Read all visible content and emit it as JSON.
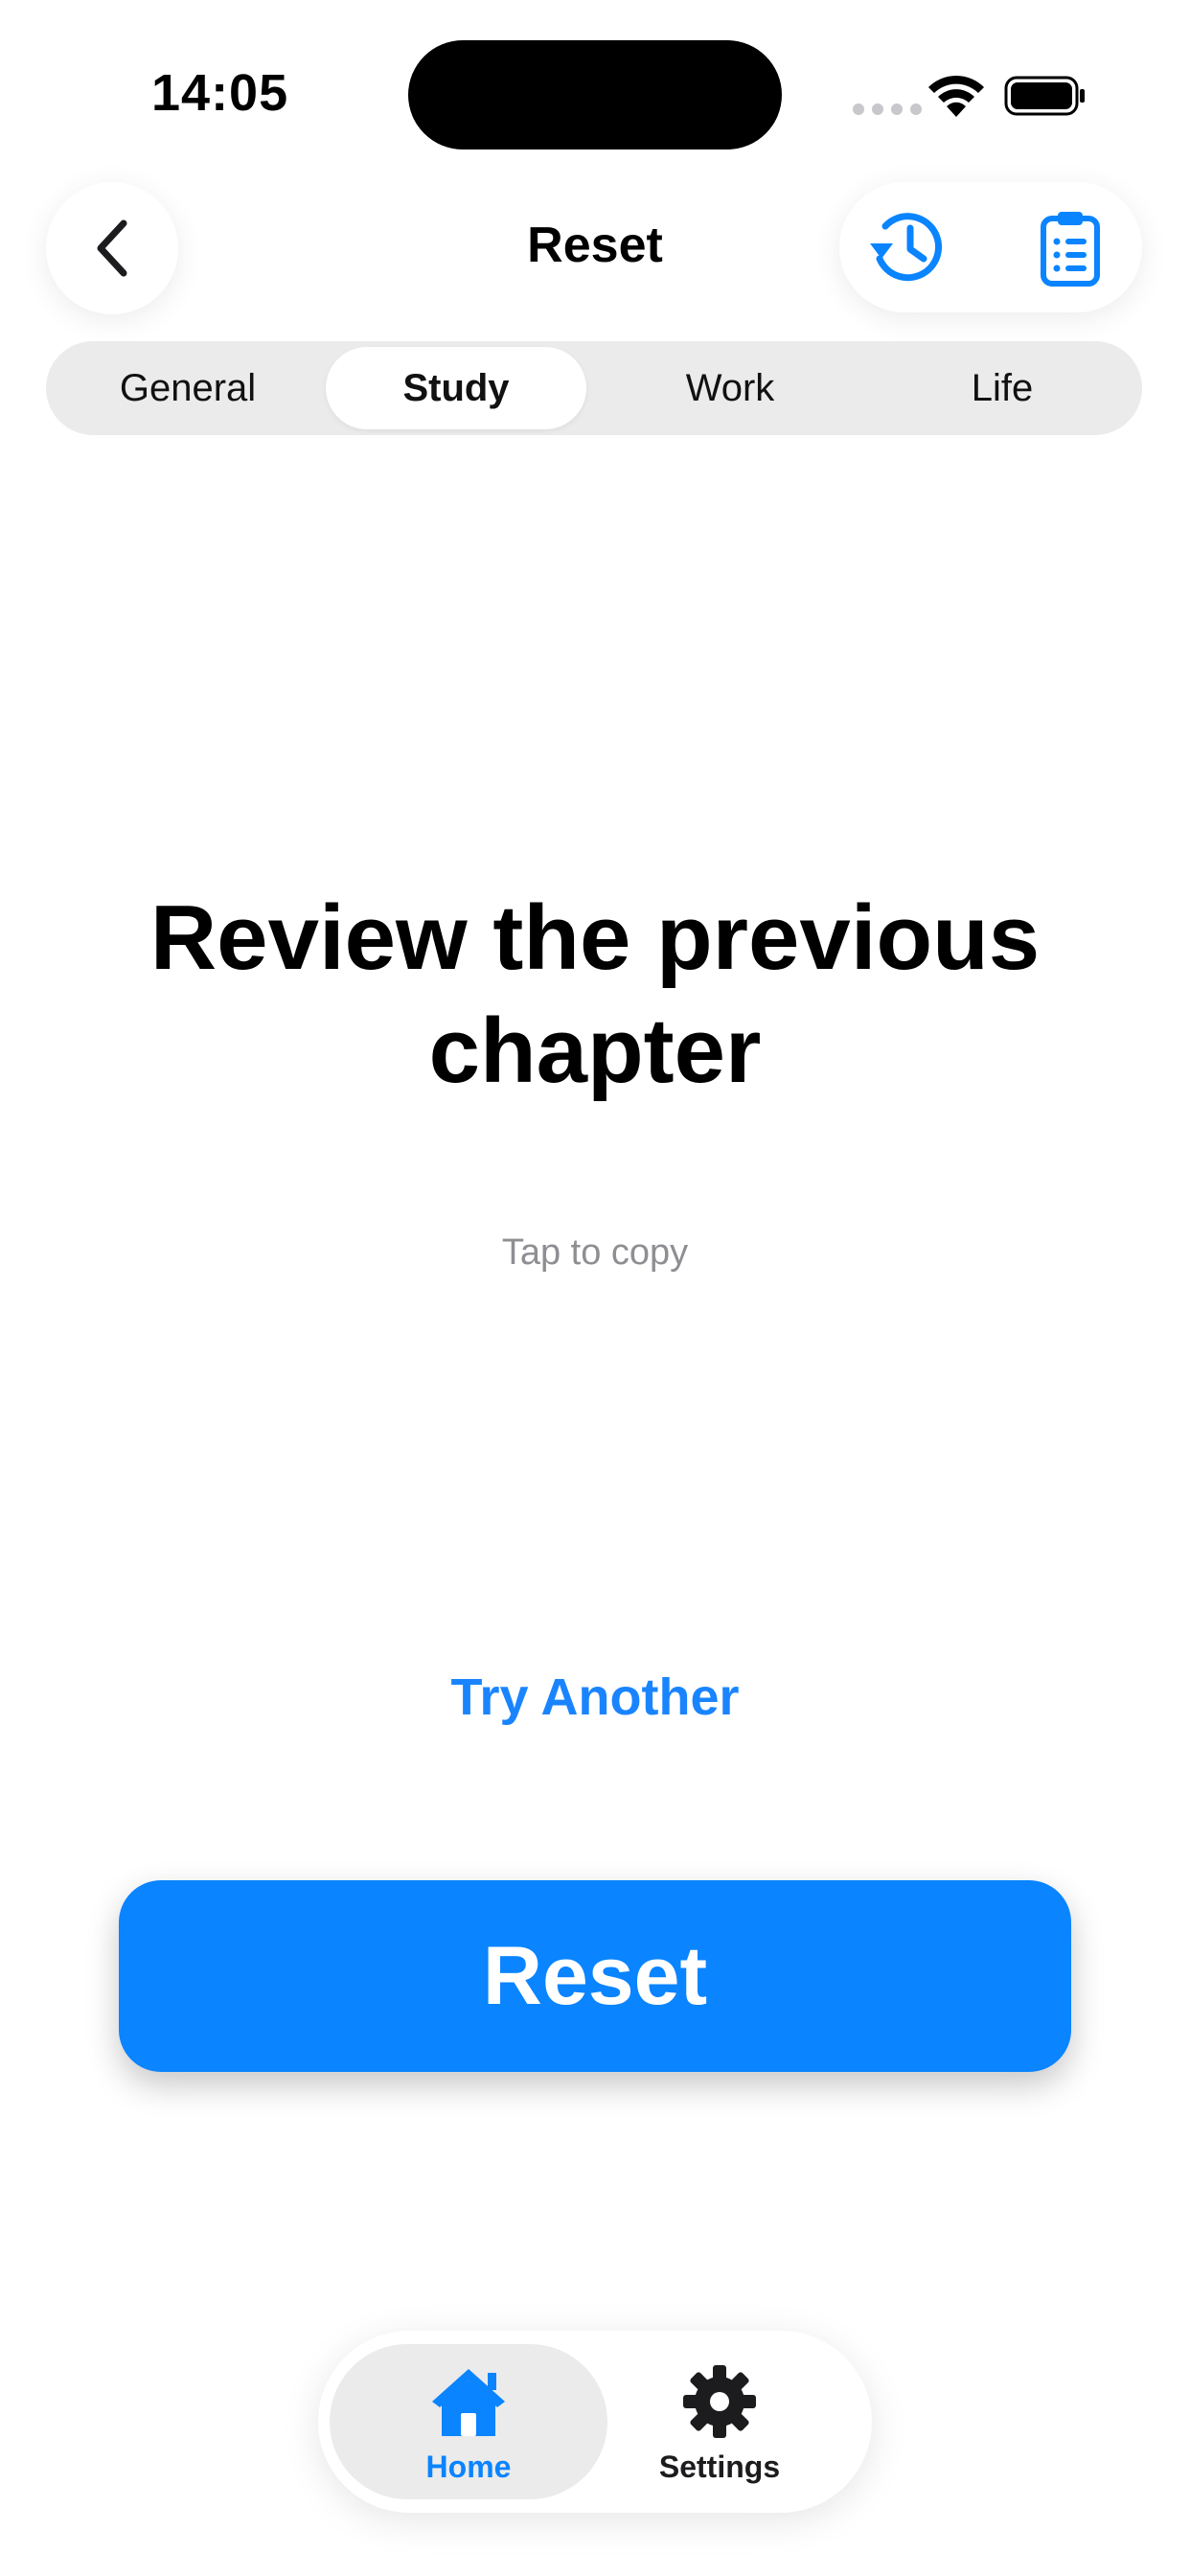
{
  "status_bar": {
    "time": "14:05"
  },
  "nav": {
    "title": "Reset",
    "back_icon": "chevron-left-icon",
    "history_icon": "clock-history-icon",
    "clipboard_icon": "clipboard-list-icon"
  },
  "segments": [
    {
      "label": "General",
      "selected": false
    },
    {
      "label": "Study",
      "selected": true
    },
    {
      "label": "Work",
      "selected": false
    },
    {
      "label": "Life",
      "selected": false
    }
  ],
  "content": {
    "prompt": "Review the previous chapter",
    "hint": "Tap to copy",
    "try_another": "Try Another",
    "reset_label": "Reset"
  },
  "tab_bar": {
    "items": [
      {
        "label": "Home",
        "icon": "house-icon",
        "active": true
      },
      {
        "label": "Settings",
        "icon": "gear-icon",
        "active": false
      }
    ]
  },
  "colors": {
    "accent": "#0a84ff",
    "background": "#ffffff",
    "segment_track": "#ebebeb",
    "hint_gray": "#8e8e93"
  }
}
